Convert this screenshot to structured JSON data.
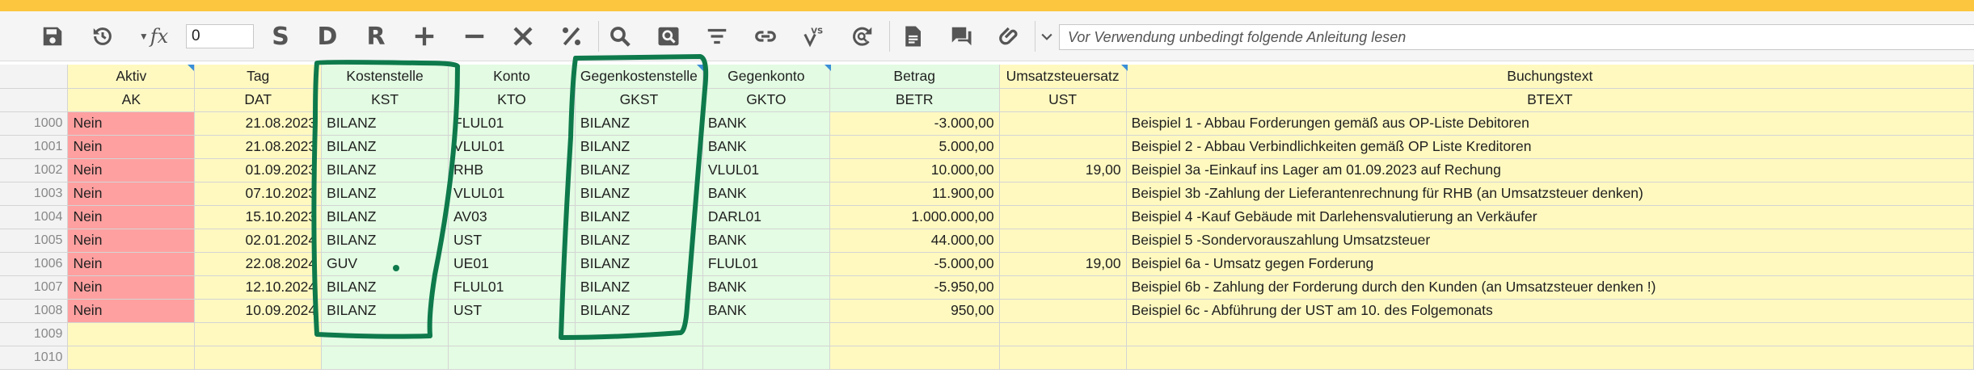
{
  "toolbar": {
    "buttons": [
      {
        "name": "save-icon"
      },
      {
        "name": "history-icon"
      },
      {
        "name": "formula-icon",
        "label": "fx"
      },
      {
        "name": "letter-s-button",
        "label": "S"
      },
      {
        "name": "letter-d-button",
        "label": "D"
      },
      {
        "name": "letter-r-button",
        "label": "R"
      },
      {
        "name": "plus-icon"
      },
      {
        "name": "minus-icon"
      },
      {
        "name": "times-icon"
      },
      {
        "name": "percent-icon"
      },
      {
        "name": "search-icon"
      },
      {
        "name": "search-box-icon"
      },
      {
        "name": "filter-icon"
      },
      {
        "name": "link-icon"
      },
      {
        "name": "versus-icon",
        "label": "VS"
      },
      {
        "name": "refresh-search-icon"
      },
      {
        "name": "document-icon"
      },
      {
        "name": "comments-icon"
      },
      {
        "name": "attachment-icon"
      },
      {
        "name": "chevron-down-icon"
      }
    ],
    "value_input": "0",
    "note_placeholder": "Vor Verwendung unbedingt folgende Anleitung lesen"
  },
  "columns": [
    {
      "title": "Aktiv",
      "code": "AK"
    },
    {
      "title": "Tag",
      "code": "DAT"
    },
    {
      "title": "Kostenstelle",
      "code": "KST"
    },
    {
      "title": "Konto",
      "code": "KTO"
    },
    {
      "title": "Gegenkostenstelle",
      "code": "GKST"
    },
    {
      "title": "Gegenkonto",
      "code": "GKTO"
    },
    {
      "title": "Betrag",
      "code": "BETR"
    },
    {
      "title": "Umsatzsteuersatz",
      "code": "UST"
    },
    {
      "title": "Buchungstext",
      "code": "BTEXT"
    }
  ],
  "rows": [
    {
      "n": "1000",
      "ak": "Nein",
      "dat": "21.08.2023",
      "kst": "BILANZ",
      "kto": "FLUL01",
      "gkst": "BILANZ",
      "gkto": "BANK",
      "betr": "-3.000,00",
      "ust": "",
      "btext": "Beispiel 1 - Abbau Forderungen gemäß aus OP-Liste Debitoren"
    },
    {
      "n": "1001",
      "ak": "Nein",
      "dat": "21.08.2023",
      "kst": "BILANZ",
      "kto": "VLUL01",
      "gkst": "BILANZ",
      "gkto": "BANK",
      "betr": "5.000,00",
      "ust": "",
      "btext": "Beispiel 2 - Abbau Verbindlichkeiten gemäß OP Liste Kreditoren"
    },
    {
      "n": "1002",
      "ak": "Nein",
      "dat": "01.09.2023",
      "kst": "BILANZ",
      "kto": "RHB",
      "gkst": "BILANZ",
      "gkto": "VLUL01",
      "betr": "10.000,00",
      "ust": "19,00",
      "btext": "Beispiel 3a -Einkauf ins Lager am 01.09.2023 auf Rechung"
    },
    {
      "n": "1003",
      "ak": "Nein",
      "dat": "07.10.2023",
      "kst": "BILANZ",
      "kto": "VLUL01",
      "gkst": "BILANZ",
      "gkto": "BANK",
      "betr": "11.900,00",
      "ust": "",
      "btext": "Beispiel 3b -Zahlung der Lieferantenrechnung für RHB (an Umsatzsteuer denken)"
    },
    {
      "n": "1004",
      "ak": "Nein",
      "dat": "15.10.2023",
      "kst": "BILANZ",
      "kto": "AV03",
      "gkst": "BILANZ",
      "gkto": "DARL01",
      "betr": "1.000.000,00",
      "ust": "",
      "btext": "Beispiel 4 -Kauf Gebäude mit Darlehensvalutierung an Verkäufer"
    },
    {
      "n": "1005",
      "ak": "Nein",
      "dat": "02.01.2024",
      "kst": "BILANZ",
      "kto": "UST",
      "gkst": "BILANZ",
      "gkto": "BANK",
      "betr": "44.000,00",
      "ust": "",
      "btext": "Beispiel 5 -Sondervorauszahlung Umsatzsteuer"
    },
    {
      "n": "1006",
      "ak": "Nein",
      "dat": "22.08.2024",
      "kst": "GUV",
      "kto": "UE01",
      "gkst": "BILANZ",
      "gkto": "FLUL01",
      "betr": "-5.000,00",
      "ust": "19,00",
      "btext": "Beispiel 6a - Umsatz gegen Forderung"
    },
    {
      "n": "1007",
      "ak": "Nein",
      "dat": "12.10.2024",
      "kst": "BILANZ",
      "kto": "FLUL01",
      "gkst": "BILANZ",
      "gkto": "BANK",
      "betr": "-5.950,00",
      "ust": "",
      "btext": "Beispiel 6b - Zahlung der Forderung durch den Kunden (an Umsatzsteuer denken !)"
    },
    {
      "n": "1008",
      "ak": "Nein",
      "dat": "10.09.2024",
      "kst": "BILANZ",
      "kto": "UST",
      "gkst": "BILANZ",
      "gkto": "BANK",
      "betr": "950,00",
      "ust": "",
      "btext": "Beispiel 6c - Abführung der UST am 10. des Folgemonats"
    }
  ],
  "empty_rows": [
    "1009",
    "1010"
  ],
  "colors": {
    "accent_strip": "#fcc63f",
    "inactive_red": "#ffa0a0",
    "highlight_green": "#0e7a4c"
  }
}
